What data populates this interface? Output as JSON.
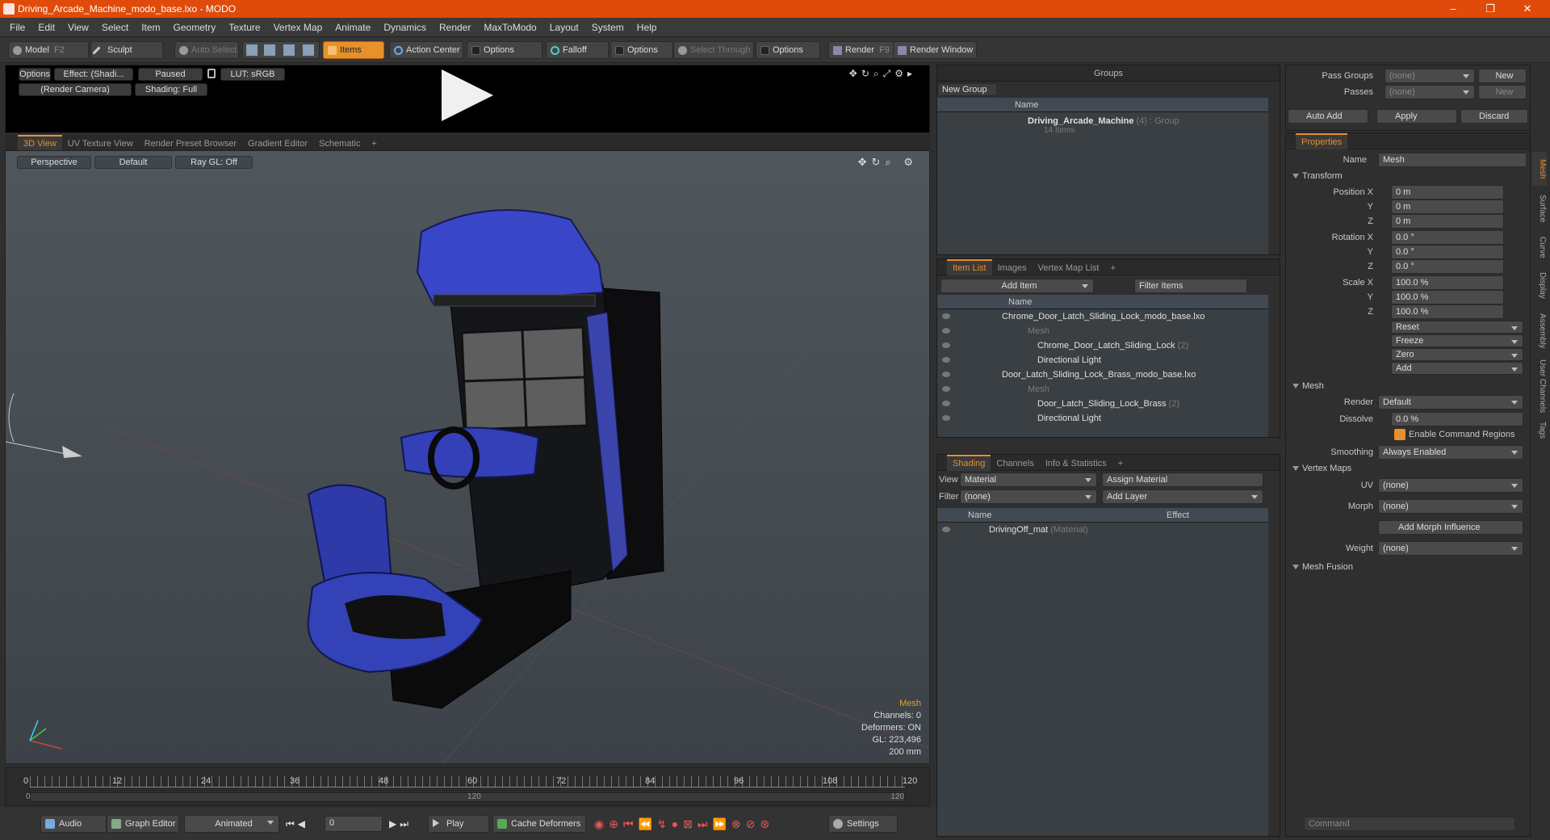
{
  "window": {
    "title": "Driving_Arcade_Machine_modo_base.lxo - MODO",
    "min": "–",
    "max": "❐",
    "close": "✕"
  },
  "menu": [
    "File",
    "Edit",
    "View",
    "Select",
    "Item",
    "Geometry",
    "Texture",
    "Vertex Map",
    "Animate",
    "Dynamics",
    "Render",
    "MaxToModo",
    "Layout",
    "System",
    "Help"
  ],
  "toolbar": {
    "model": "Model",
    "model_key": "F2",
    "sculpt": "Sculpt",
    "auto_select": "Auto Select",
    "items": "Items",
    "action_center": "Action Center",
    "options1": "Options",
    "falloff": "Falloff",
    "options2": "Options",
    "select_through": "Select Through",
    "options3": "Options",
    "render": "Render",
    "render_key": "F9",
    "render_window": "Render Window"
  },
  "preview": {
    "options": "Options",
    "effect": "Effect: (Shadi...",
    "paused": "Paused",
    "lut": "LUT: sRGB",
    "camera": "(Render Camera)",
    "shading": "Shading: Full"
  },
  "viewport_tabs": [
    "3D View",
    "UV Texture View",
    "Render Preset Browser",
    "Gradient Editor",
    "Schematic",
    "+"
  ],
  "viewport": {
    "perspective": "Perspective",
    "default": "Default",
    "raygl": "Ray GL: Off",
    "hud_title": "Mesh",
    "hud_channels": "Channels: 0",
    "hud_deformers": "Deformers: ON",
    "hud_gl": "GL: 223,496",
    "hud_size": "200 mm"
  },
  "timeline": {
    "ticks": [
      "0",
      "12",
      "24",
      "36",
      "48",
      "60",
      "72",
      "84",
      "96",
      "108",
      "120"
    ],
    "start": "0",
    "end": "120",
    "mid": "120"
  },
  "bottom": {
    "audio": "Audio",
    "graph_editor": "Graph Editor",
    "animated": "Animated",
    "frame": "0",
    "play": "Play",
    "cache_deformers": "Cache Deformers",
    "settings": "Settings"
  },
  "groups": {
    "title": "Groups",
    "new_group": "New Group",
    "col_name": "Name",
    "group_name": "Driving_Arcade_Machine",
    "group_count": "(4)",
    "group_type": ": Group",
    "group_items": "14 Items"
  },
  "item_list": {
    "tabs": [
      "Item List",
      "Images",
      "Vertex Map List",
      "+"
    ],
    "add_item": "Add Item",
    "filter_items": "Filter Items",
    "col_name": "Name",
    "rows": [
      {
        "label": "Chrome_Door_Latch_Sliding_Lock_modo_base.lxo",
        "sub": ""
      },
      {
        "label": "Mesh",
        "sub": ""
      },
      {
        "label": "Chrome_Door_Latch_Sliding_Lock",
        "sub": "(2)"
      },
      {
        "label": "Directional Light",
        "sub": ""
      },
      {
        "label": "Door_Latch_Sliding_Lock_Brass_modo_base.lxo",
        "sub": ""
      },
      {
        "label": "Mesh",
        "sub": ""
      },
      {
        "label": "Door_Latch_Sliding_Lock_Brass",
        "sub": "(2)"
      },
      {
        "label": "Directional Light",
        "sub": ""
      }
    ]
  },
  "shading": {
    "tabs": [
      "Shading",
      "Channels",
      "Info & Statistics",
      "+"
    ],
    "view_label": "View",
    "view_value": "Material",
    "assign_material": "Assign Material",
    "filter_label": "Filter",
    "filter_value": "(none)",
    "add_layer": "Add Layer",
    "col_name": "Name",
    "col_effect": "Effect",
    "mat_name": "DrivingOff_mat",
    "mat_type": "(Material)"
  },
  "passes": {
    "pass_groups": "Pass Groups",
    "pass_groups_value": "(none)",
    "new1": "New",
    "passes": "Passes",
    "passes_value": "(none)",
    "new2": "New",
    "auto_add": "Auto Add",
    "apply": "Apply",
    "discard": "Discard"
  },
  "properties": {
    "tab": "Properties",
    "name_label": "Name",
    "name_value": "Mesh",
    "transform": "Transform",
    "posx_l": "Position X",
    "posx": "0 m",
    "posy_l": "Y",
    "posy": "0 m",
    "posz_l": "Z",
    "posz": "0 m",
    "rotx_l": "Rotation X",
    "rotx": "0.0 °",
    "roty_l": "Y",
    "roty": "0.0 °",
    "rotz_l": "Z",
    "rotz": "0.0 °",
    "sclx_l": "Scale X",
    "sclx": "100.0 %",
    "scly_l": "Y",
    "scly": "100.0 %",
    "sclz_l": "Z",
    "sclz": "100.0 %",
    "reset": "Reset",
    "freeze": "Freeze",
    "zero": "Zero",
    "add": "Add",
    "mesh": "Mesh",
    "render_l": "Render",
    "render_v": "Default",
    "dissolve_l": "Dissolve",
    "dissolve_v": "0.0 %",
    "enable_cmd": "Enable Command Regions",
    "smoothing_l": "Smoothing",
    "smoothing_v": "Always Enabled",
    "vertex_maps": "Vertex Maps",
    "uv_l": "UV",
    "uv_v": "(none)",
    "morph_l": "Morph",
    "morph_v": "(none)",
    "add_morph": "Add Morph Influence",
    "weight_l": "Weight",
    "weight_v": "(none)",
    "mesh_fusion": "Mesh Fusion",
    "command": "Command"
  },
  "side_tabs": [
    "Mesh",
    "Surface",
    "Curve",
    "Display",
    "Assembly",
    "User Channels",
    "Tags"
  ]
}
